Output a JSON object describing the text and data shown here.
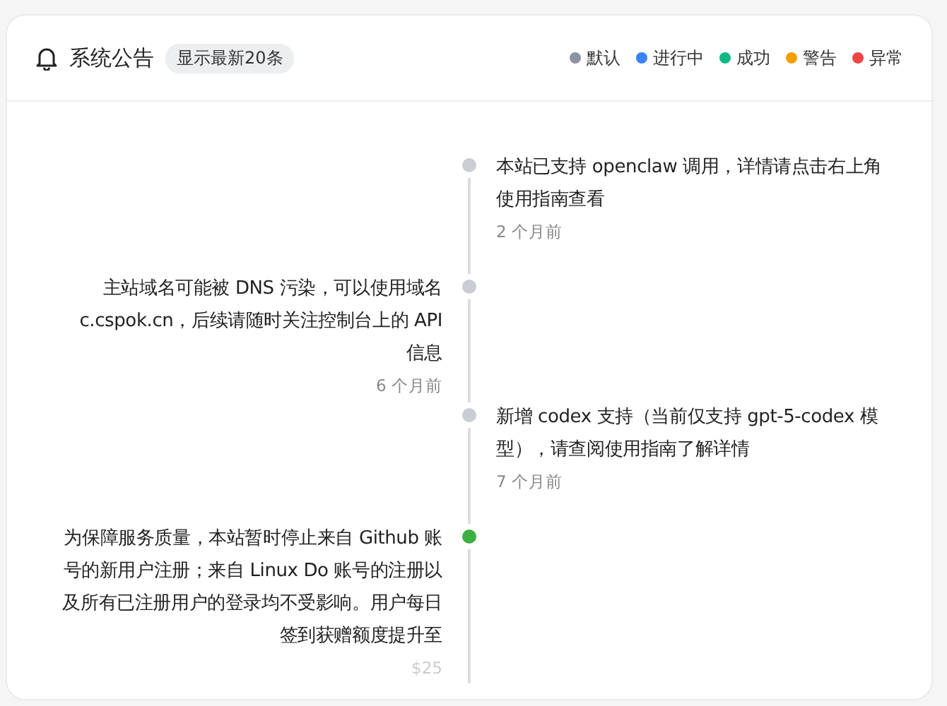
{
  "header": {
    "title": "系统公告",
    "badge": "显示最新20条"
  },
  "legend": [
    {
      "label": "默认",
      "color": "#8b95a1"
    },
    {
      "label": "进行中",
      "color": "#3b82f6"
    },
    {
      "label": "成功",
      "color": "#10b981"
    },
    {
      "label": "警告",
      "color": "#f59e0b"
    },
    {
      "label": "异常",
      "color": "#ef4444"
    }
  ],
  "timeline": [
    {
      "kind": "right",
      "text": "本站已支持 openclaw 调用，详情请点击右上角使用指南查看",
      "time": "2 个月前",
      "color": "#c9cdd4"
    },
    {
      "kind": "left",
      "text": "主站域名可能被 DNS 污染，可以使用域名 c.cspok.cn，后续请随时关注控制台上的 API 信息",
      "time": "6 个月前",
      "color": "#c9cdd4"
    },
    {
      "kind": "right",
      "text": "新增 codex 支持（当前仅支持 gpt-5-codex 模型），请查阅使用指南了解详情",
      "time": "7 个月前",
      "color": "#c9cdd4"
    },
    {
      "kind": "left",
      "text": "为保障服务质量，本站暂时停止来自 Github 账号的新用户注册；来自 Linux Do 账号的注册以及所有已注册用户的登录均不受影响。用户每日签到获赠额度提升至",
      "time": "$25",
      "color": "#3cb043"
    }
  ]
}
